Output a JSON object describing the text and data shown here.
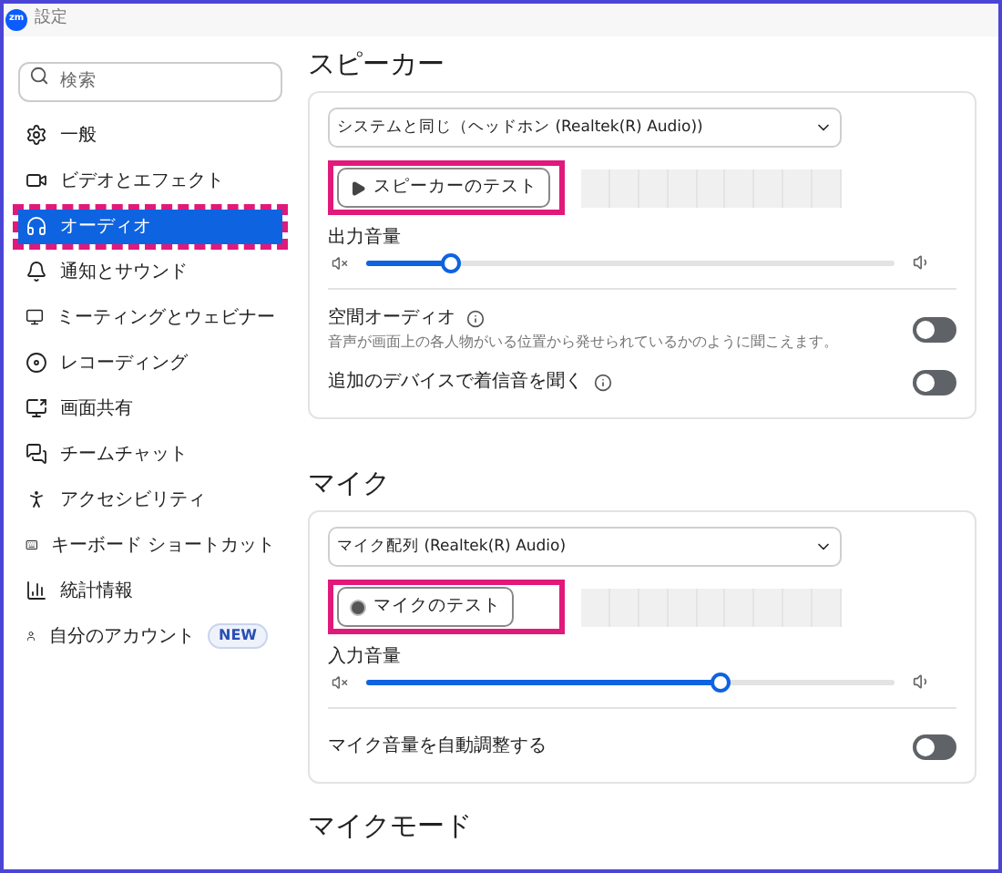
{
  "window": {
    "logo": "zm",
    "title": "設定"
  },
  "search": {
    "placeholder": "検索"
  },
  "sidebar": {
    "items": [
      {
        "kind": "gear",
        "label": "一般",
        "selected": false,
        "annotated": false
      },
      {
        "kind": "video",
        "label": "ビデオとエフェクト",
        "selected": false,
        "annotated": false
      },
      {
        "kind": "headphones",
        "label": "オーディオ",
        "selected": true,
        "annotated": true
      },
      {
        "kind": "bell",
        "label": "通知とサウンド",
        "selected": false,
        "annotated": false
      },
      {
        "kind": "monitor",
        "label": "ミーティングとウェビナー",
        "selected": false,
        "annotated": false
      },
      {
        "kind": "record",
        "label": "レコーディング",
        "selected": false,
        "annotated": false
      },
      {
        "kind": "share",
        "label": "画面共有",
        "selected": false,
        "annotated": false
      },
      {
        "kind": "chat",
        "label": "チームチャット",
        "selected": false,
        "annotated": false
      },
      {
        "kind": "person",
        "label": "アクセシビリティ",
        "selected": false,
        "annotated": false
      },
      {
        "kind": "keyboard",
        "label": "キーボード ショートカット",
        "selected": false,
        "annotated": false
      },
      {
        "kind": "chart",
        "label": "統計情報",
        "selected": false,
        "annotated": false
      },
      {
        "kind": "user",
        "label": "自分のアカウント",
        "selected": false,
        "annotated": false,
        "badge": "NEW"
      }
    ]
  },
  "sections": [
    {
      "heading": "スピーカー",
      "device": "システムと同じ（ヘッドホン (Realtek(R) Audio))",
      "test_button": {
        "kind": "play",
        "label": "スピーカーのテスト",
        "annotated": true
      },
      "volume_label": "出力音量",
      "volume": {
        "level": 0.16
      },
      "options": [
        {
          "label": "空間オーディオ",
          "info": true,
          "description": "音声が画面上の各人物がいる位置から発せられているかのように聞こえます。",
          "on": false
        },
        {
          "label": "追加のデバイスで着信音を聞く",
          "info": true,
          "on": false
        }
      ]
    },
    {
      "heading": "マイク",
      "device": "マイク配列 (Realtek(R) Audio)",
      "test_button": {
        "kind": "record",
        "label": "マイクのテスト",
        "annotated": true
      },
      "volume_label": "入力音量",
      "volume": {
        "level": 0.67
      },
      "options": [
        {
          "label": "マイク音量を自動調整する",
          "info": false,
          "on": false
        }
      ]
    }
  ],
  "next_heading": "マイクモード"
}
